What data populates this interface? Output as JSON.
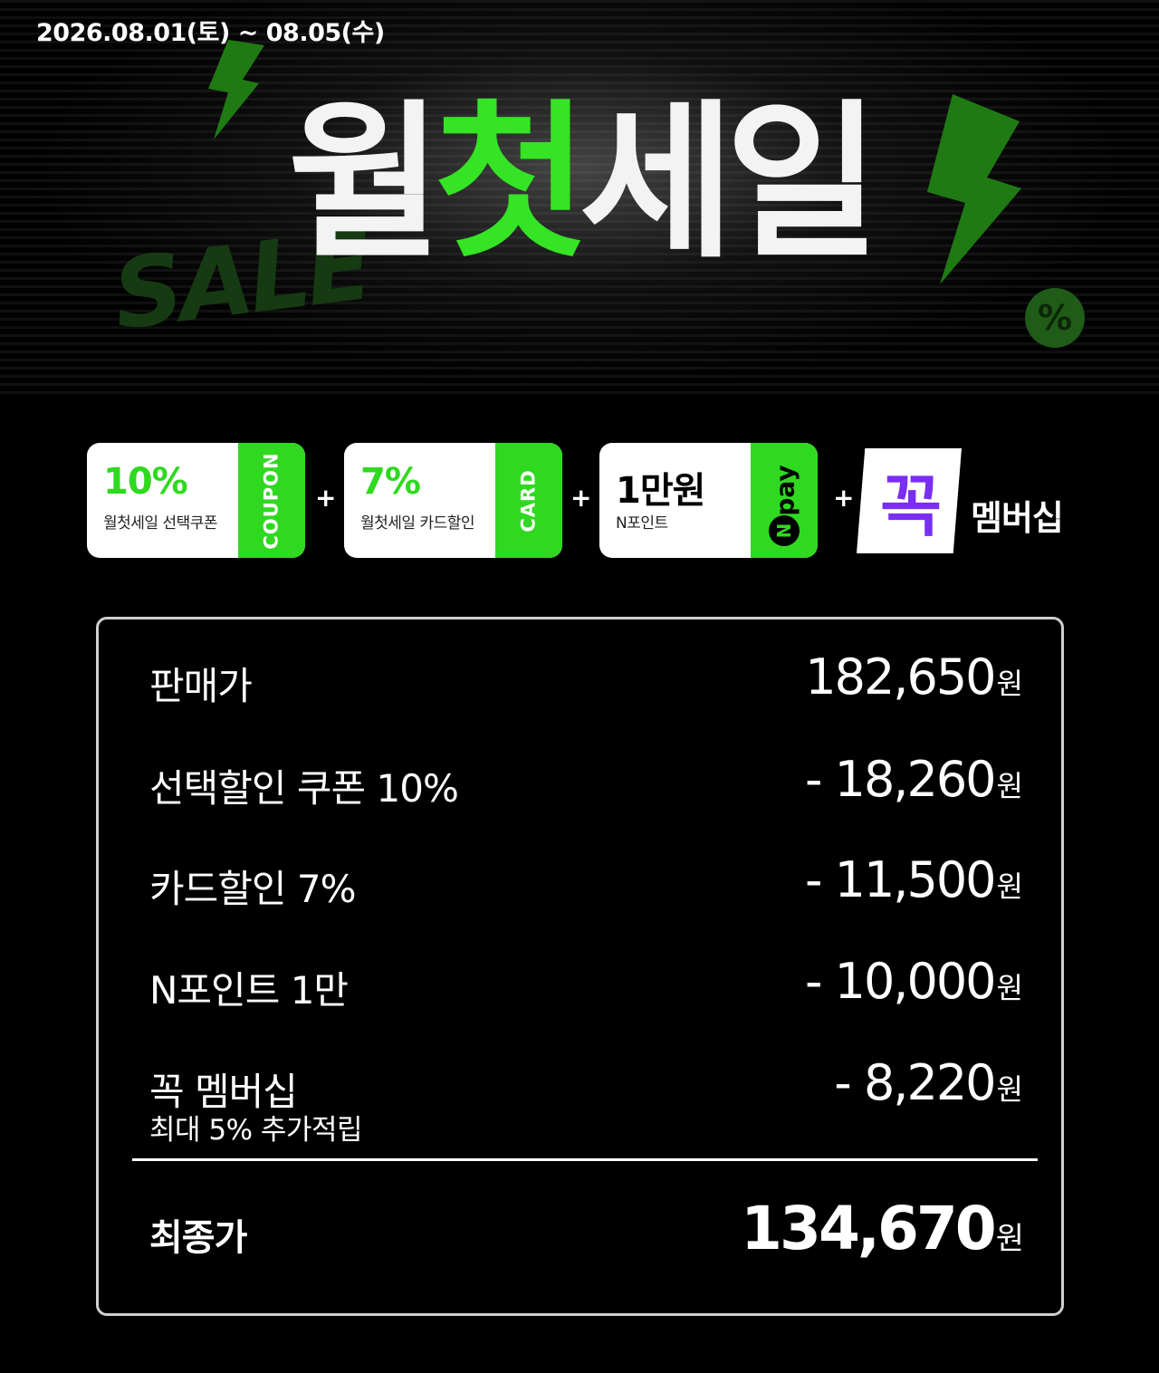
{
  "banner": {
    "date_range": "2026.08.01(토) ~ 08.05(수)",
    "title_a": "월",
    "title_b": "첫",
    "title_c": "세일",
    "graffiti": "SALE",
    "percent_badge": "%",
    "accent_color": "#35e425"
  },
  "benefits": {
    "coupon": {
      "main": "10%",
      "sub": "월첫세일 선택쿠폰",
      "stub": "COUPON"
    },
    "card": {
      "main": "7%",
      "sub": "월첫세일 카드할인",
      "stub": "CARD"
    },
    "npay": {
      "main": "1만원",
      "sub": "N포인트",
      "stub": "pay",
      "stub_icon": "N"
    },
    "membership": {
      "logo": "꼭",
      "label": "멤버십",
      "logo_color": "#7a2ef0"
    },
    "plus": "+"
  },
  "price": {
    "currency": "원",
    "rows": [
      {
        "label": "판매가",
        "value": "182,650"
      },
      {
        "label": "선택할인 쿠폰 10%",
        "value": "- 18,260"
      },
      {
        "label": "카드할인 7%",
        "value": "- 11,500"
      },
      {
        "label": "N포인트 1만",
        "value": "- 10,000"
      },
      {
        "label": "꼭 멤버십",
        "sublabel": "최대 5% 추가적립",
        "value": "- 8,220"
      }
    ],
    "total": {
      "label": "최종가",
      "value": "134,670"
    }
  }
}
